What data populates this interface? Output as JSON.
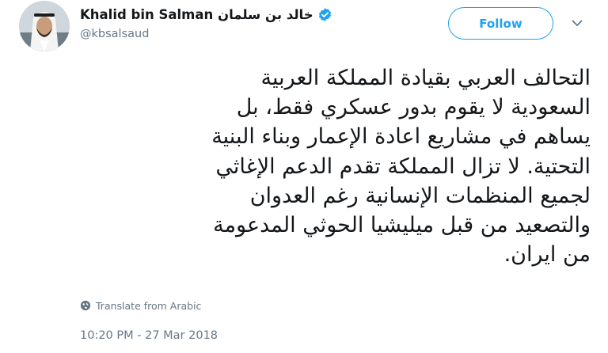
{
  "author": {
    "display_name": "Khalid bin Salman خالد بن سلمان",
    "handle": "@kbsalsaud",
    "verified": true,
    "avatar_icon": "profile-photo"
  },
  "actions": {
    "follow_label": "Follow",
    "more_icon": "chevron-down-icon"
  },
  "tweet": {
    "lines": [
      "التحالف العربي بقيادة المملكة العربية",
      "السعودية لا يقوم بدور عسكري فقط، بل",
      "يساهم في مشاريع اعادة الإعمار وبناء البنية",
      "التحتية. لا تزال المملكة تقدم الدعم الإغاثي",
      "لجميع المنظمات الإنسانية رغم العدوان",
      "والتصعيد من قبل ميليشيا الحوثي المدعومة",
      "من ايران."
    ],
    "translate_label": "Translate from Arabic",
    "timestamp": "10:20 PM - 27 Mar 2018"
  },
  "colors": {
    "brand_blue": "#1da1f2",
    "text_primary": "#14171a",
    "text_secondary": "#657786"
  }
}
